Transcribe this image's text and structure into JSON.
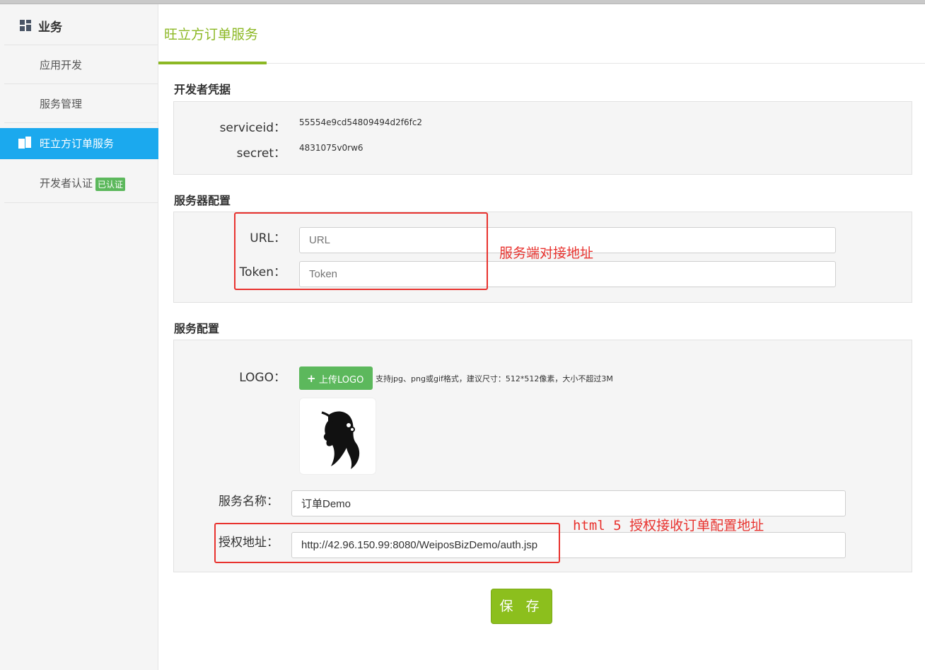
{
  "sidebar": {
    "section_title": "业务",
    "items": [
      {
        "label": "应用开发"
      },
      {
        "label": "服务管理"
      },
      {
        "label": "旺立方订单服务"
      },
      {
        "label": "开发者认证",
        "badge": "已认证"
      }
    ]
  },
  "page": {
    "title": "旺立方订单服务"
  },
  "credentials": {
    "section_title": "开发者凭据",
    "serviceid_label": "serviceid：",
    "serviceid_value": "55554e9cd54809494d2f6fc2",
    "secret_label": "secret：",
    "secret_value": "4831075v0rw6"
  },
  "server_config": {
    "section_title": "服务器配置",
    "url_label": "URL：",
    "url_placeholder": "URL",
    "token_label": "Token：",
    "token_placeholder": "Token"
  },
  "service_config": {
    "section_title": "服务配置",
    "logo_label": "LOGO：",
    "upload_button": "上传LOGO",
    "upload_hint": "支持jpg、png或gif格式，建议尺寸：512*512像素，大小不超过3M",
    "name_label": "服务名称：",
    "name_value": "订单Demo",
    "auth_label": "授权地址：",
    "auth_value": "http://42.96.150.99:8080/WeiposBizDemo/auth.jsp"
  },
  "annotations": {
    "server_note": "服务端对接地址",
    "auth_note": "html 5 授权接收订单配置地址",
    "color": "#e8322e"
  },
  "save_button": "保 存",
  "colors": {
    "accent": "#8cb824",
    "active": "#1ba9ee",
    "success": "#5cb85c"
  }
}
